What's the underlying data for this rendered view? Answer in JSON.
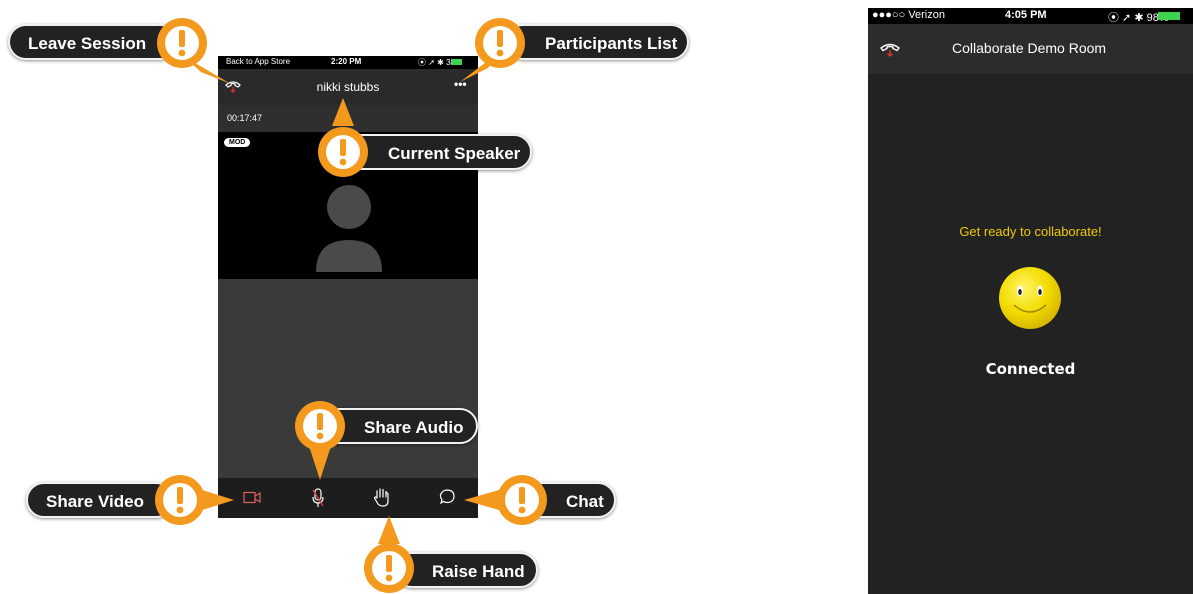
{
  "left_phone": {
    "status_bar": {
      "back_label": "Back to App Store",
      "time": "2:20 PM",
      "indicators": "⦿ ➚ ✱ 38%"
    },
    "header": {
      "speaker_name": "nikki stubbs",
      "more_label": "•••"
    },
    "timer": "00:17:47",
    "moderator_badge": "MOD",
    "toolbar": [
      "share-video-icon",
      "microphone-icon",
      "raise-hand-icon",
      "chat-icon"
    ]
  },
  "callouts": {
    "leave_session": "Leave Session",
    "participants_list": "Participants List",
    "current_speaker": "Current Speaker",
    "share_audio": "Share Audio",
    "share_video": "Share Video",
    "chat": "Chat",
    "raise_hand": "Raise Hand"
  },
  "right_phone": {
    "status_bar": {
      "carrier": "●●●○○ Verizon",
      "time": "4:05 PM",
      "indicators": "⦿ ➚ ✱ 98%"
    },
    "header": {
      "room_title": "Collaborate Demo Room"
    },
    "ready_message": "Get ready to collaborate!",
    "status": "Connected"
  },
  "colors": {
    "callout_orange": "#f39a1e",
    "callout_pill": "#222222",
    "ready_text": "#f0c800",
    "hangup_red": "#d9302c",
    "battery_green": "#3bd44c"
  }
}
